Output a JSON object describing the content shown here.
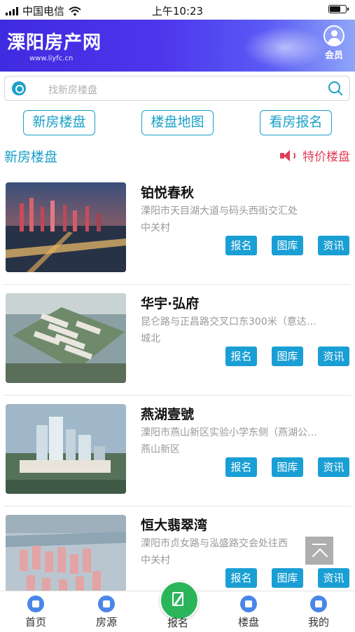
{
  "status_bar": {
    "carrier": "中国电信",
    "time": "上午10:23",
    "battery_level": 0.7
  },
  "header": {
    "title": "溧阳房产网",
    "site": "www.liyfc.cn",
    "member_label": "会员"
  },
  "search": {
    "placeholder": "找新房楼盘"
  },
  "nav_buttons": [
    {
      "label": "新房楼盘"
    },
    {
      "label": "楼盘地图"
    },
    {
      "label": "看房报名"
    }
  ],
  "section": {
    "left_title": "新房楼盘",
    "right_title": "特价楼盘"
  },
  "listings": [
    {
      "name": "铂悦春秋",
      "address": "溧阳市天目湖大道与码头西街交汇处",
      "area": "中关村",
      "btn_signup": "报名",
      "btn_gallery": "图库",
      "btn_news": "资讯"
    },
    {
      "name": "华宇·弘府",
      "address": "昆仑路与正昌路交叉口东300米（意达…",
      "area": "城北",
      "btn_signup": "报名",
      "btn_gallery": "图库",
      "btn_news": "资讯"
    },
    {
      "name": "燕湖壹號",
      "address": "溧阳市燕山新区实验小学东侧（燕湖公…",
      "area": "燕山新区",
      "btn_signup": "报名",
      "btn_gallery": "图库",
      "btn_news": "资讯"
    },
    {
      "name": "恒大翡翠湾",
      "address": "溧阳市贞女路与泓盛路交会处往西",
      "area": "中关村",
      "btn_signup": "报名",
      "btn_gallery": "图库",
      "btn_news": "资讯"
    }
  ],
  "tabbar": [
    {
      "label": "首页"
    },
    {
      "label": "房源"
    },
    {
      "label": "报名"
    },
    {
      "label": "楼盘"
    },
    {
      "label": "我的"
    }
  ],
  "colors": {
    "accent": "#1aa0c8",
    "header": "#4a36ea",
    "promo": "#e03d56",
    "tab_center": "#2bb55a"
  }
}
